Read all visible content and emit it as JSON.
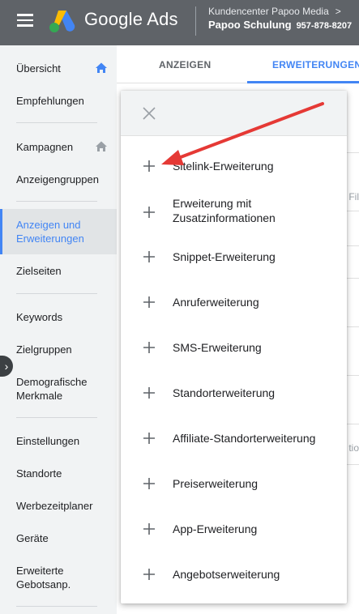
{
  "header": {
    "brand": "Google Ads",
    "account_manager": "Kundencenter Papoo Media",
    "account_name": "Papoo Schulung",
    "account_id": "957-878-8207",
    "chevron": ">"
  },
  "sidebar": {
    "items": [
      {
        "label": "Übersicht",
        "icon": "home-icon"
      },
      {
        "label": "Empfehlungen"
      },
      {
        "label": "Kampagnen",
        "icon": "home-icon"
      },
      {
        "label": "Anzeigengruppen"
      },
      {
        "label": "Anzeigen und Erweiterungen",
        "active": true
      },
      {
        "label": "Zielseiten"
      },
      {
        "label": "Keywords"
      },
      {
        "label": "Zielgruppen"
      },
      {
        "label": "Demografische Merkmale"
      },
      {
        "label": "Einstellungen"
      },
      {
        "label": "Standorte"
      },
      {
        "label": "Werbezeitplaner"
      },
      {
        "label": "Geräte"
      },
      {
        "label": "Erweiterte Gebotsanp."
      }
    ],
    "expander": "›"
  },
  "tabs": [
    {
      "label": "ANZEIGEN"
    },
    {
      "label": "ERWEITERUNGEN",
      "active": true
    }
  ],
  "background": {
    "frag1": "Fil",
    "frag2": "tio"
  },
  "menu": {
    "items": [
      {
        "label": "Sitelink-Erweiterung"
      },
      {
        "label": "Erweiterung mit Zusatzinformationen"
      },
      {
        "label": "Snippet-Erweiterung"
      },
      {
        "label": "Anruferweiterung"
      },
      {
        "label": "SMS-Erweiterung"
      },
      {
        "label": "Standorterweiterung"
      },
      {
        "label": "Affiliate-Standorterweiterung"
      },
      {
        "label": "Preiserweiterung"
      },
      {
        "label": "App-Erweiterung"
      },
      {
        "label": "Angebotserweiterung"
      }
    ]
  },
  "colors": {
    "header_bg": "#5f6368",
    "accent": "#4285f4",
    "arrow": "#e53935"
  }
}
